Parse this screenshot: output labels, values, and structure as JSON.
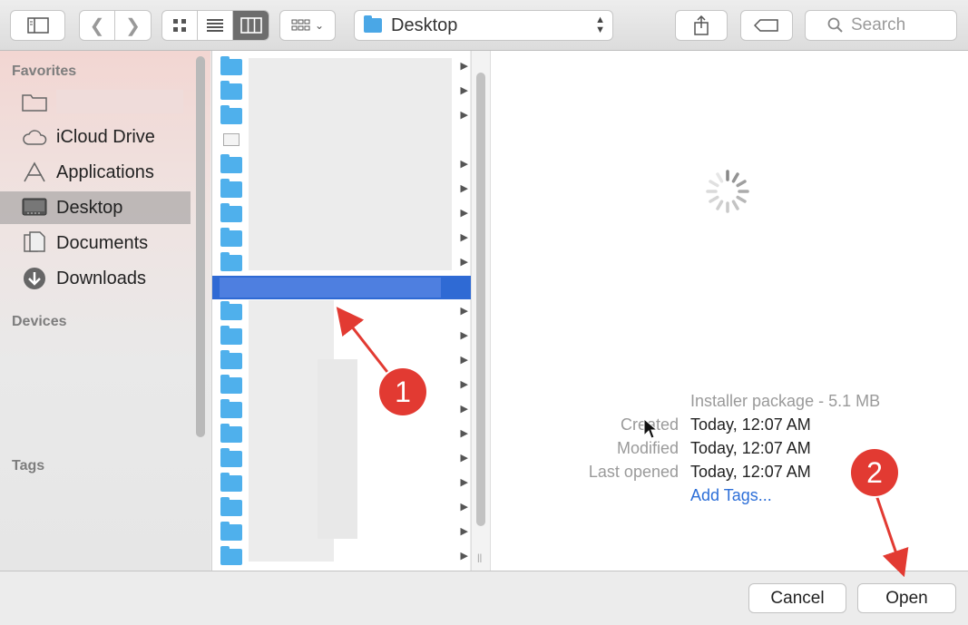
{
  "toolbar": {
    "path_label": "Desktop",
    "search_placeholder": "Search"
  },
  "sidebar": {
    "favorites_heading": "Favorites",
    "devices_heading": "Devices",
    "tags_heading": "Tags",
    "items": [
      {
        "label": "",
        "icon": "folder-icon"
      },
      {
        "label": "iCloud Drive",
        "icon": "cloud-icon"
      },
      {
        "label": "Applications",
        "icon": "applications-icon"
      },
      {
        "label": "Desktop",
        "icon": "desktop-icon",
        "selected": true
      },
      {
        "label": "Documents",
        "icon": "documents-icon"
      },
      {
        "label": "Downloads",
        "icon": "downloads-icon"
      }
    ]
  },
  "preview": {
    "kind": "Installer package - 5.1 MB",
    "created_label": "Created",
    "created_value": "Today, 12:07 AM",
    "modified_label": "Modified",
    "modified_value": "Today, 12:07 AM",
    "last_opened_label": "Last opened",
    "last_opened_value": "Today, 12:07 AM",
    "add_tags": "Add Tags..."
  },
  "buttons": {
    "cancel": "Cancel",
    "open": "Open"
  },
  "annotations": {
    "badge1": "1",
    "badge2": "2",
    "color": "#e23a32"
  }
}
